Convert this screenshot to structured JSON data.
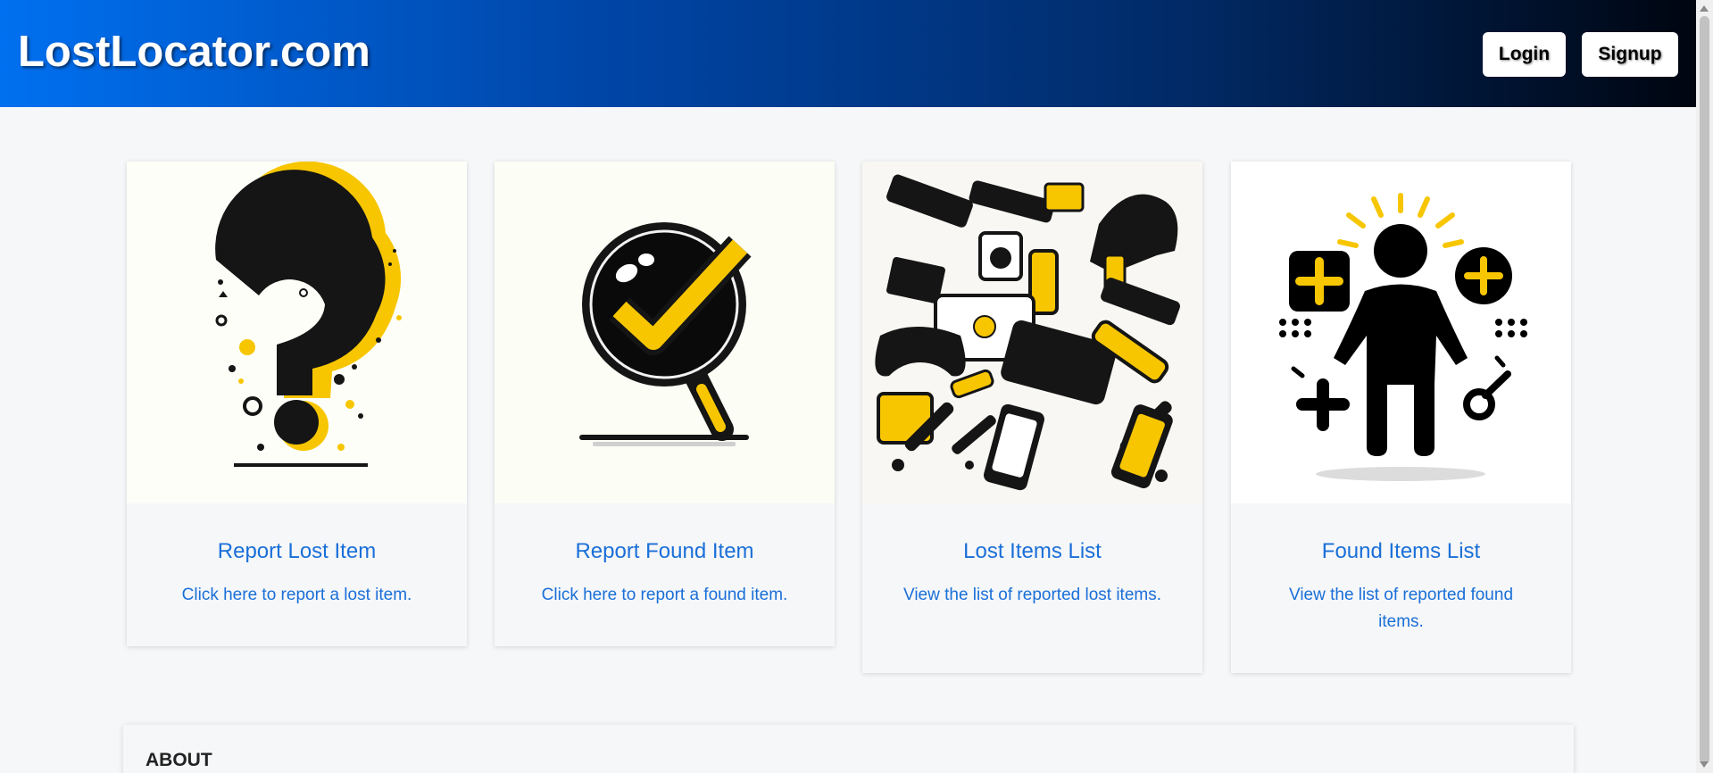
{
  "header": {
    "brand": "LostLocator.com",
    "login_label": "Login",
    "signup_label": "Signup"
  },
  "cards": [
    {
      "title": "Report Lost Item",
      "description": "Click here to report a lost item.",
      "icon": "question-mark-icon"
    },
    {
      "title": "Report Found Item",
      "description": "Click here to report a found item.",
      "icon": "magnifier-checkmark-icon"
    },
    {
      "title": "Lost Items List",
      "description": "View the list of reported lost items.",
      "icon": "assorted-items-icon"
    },
    {
      "title": "Found Items List",
      "description": "View the list of reported found items.",
      "icon": "person-plus-icon"
    }
  ],
  "about": {
    "title": "ABOUT"
  },
  "colors": {
    "accent": "#1a6fd8",
    "brand_yellow": "#f7c600",
    "header_start": "#0070f0",
    "header_end": "#000510"
  }
}
